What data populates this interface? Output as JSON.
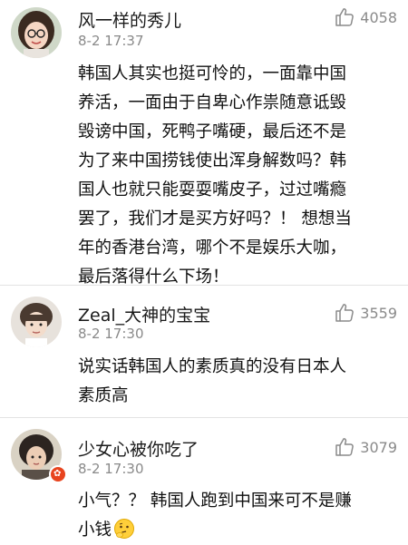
{
  "comments": [
    {
      "username": "风一样的秀儿",
      "time": "8-2 17:37",
      "likes": "4058",
      "avatar_icon": "avatar-girl-glasses-icon",
      "lines": [
        "韩国人其实也挺可怜的，一面靠中国",
        "养活，一面由于自卑心作祟随意诋毁",
        "毁谤中国，死鸭子嘴硬，最后还不是",
        "为了来中国捞钱使出浑身解数吗？韩",
        "国人也就只能耍耍嘴皮子，过过嘴瘾",
        "罢了，我们才是买方好吗？！ 想想当",
        "年的香港台湾，哪个不是娱乐大咖，",
        "最后落得什么下场！"
      ]
    },
    {
      "username": "Zeal_大神的宝宝",
      "time": "8-2 17:30",
      "likes": "3559",
      "avatar_icon": "avatar-boy-icon",
      "lines": [
        "说实话韩国人的素质真的没有日本人",
        "素质高"
      ]
    },
    {
      "username": "少女心被你吃了",
      "time": "8-2 17:30",
      "likes": "3079",
      "avatar_icon": "avatar-user-icon",
      "badge_icon": "verified-badge-icon",
      "lines": [
        "小气？？ 韩国人跑到中国来可不是赚",
        "小钱"
      ],
      "emoji": "thinking-emoji-icon"
    }
  ],
  "colors": {
    "text": "#111111",
    "meta": "#8a8a8a",
    "divider": "#e3e3e3",
    "badge": "#e8441e"
  }
}
